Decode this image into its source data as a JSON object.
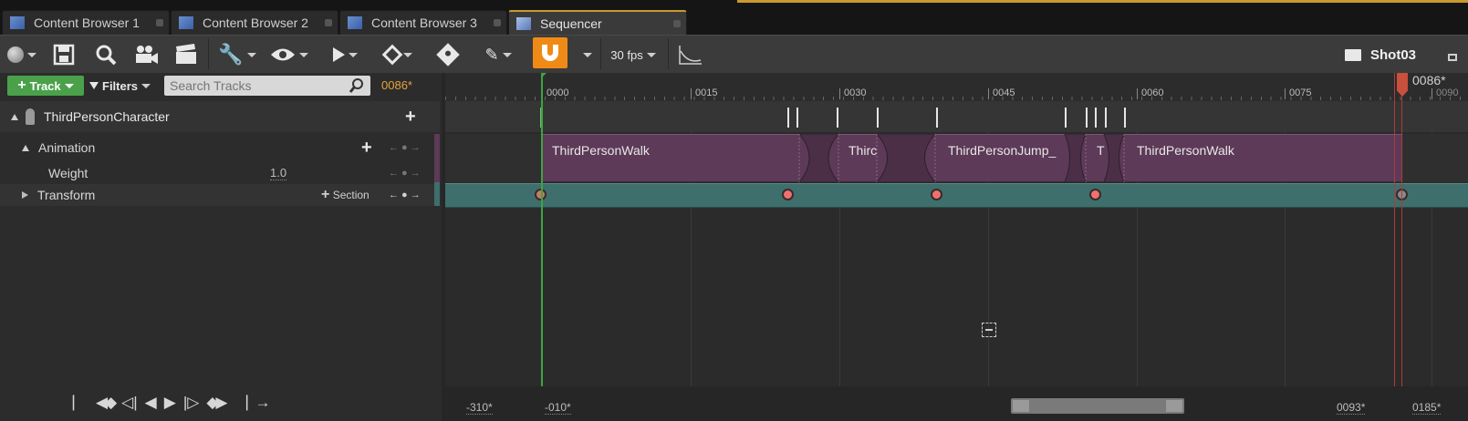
{
  "tabs": [
    {
      "label": "Content Browser 1"
    },
    {
      "label": "Content Browser 2"
    },
    {
      "label": "Content Browser 3"
    },
    {
      "label": "Sequencer"
    }
  ],
  "toolbar": {
    "fps": "30 fps",
    "sequence_name": "Shot03"
  },
  "track_bar": {
    "track_button": "Track",
    "filters_button": "Filters",
    "search_placeholder": "Search Tracks",
    "current_frame": "0086*"
  },
  "tracks": {
    "actor": "ThirdPersonCharacter",
    "animation": "Animation",
    "weight_label": "Weight",
    "weight_value": "1.0",
    "transform": "Transform",
    "section_button": "Section"
  },
  "ruler": {
    "playhead_label": "0086*",
    "ticks": [
      "0000",
      "0015",
      "0030",
      "0045",
      "0060",
      "0075",
      "0090"
    ]
  },
  "clips": {
    "c1": "ThirdPersonWalk",
    "c2": "Thirc",
    "c3": "ThirdPersonJump_",
    "c4": "T",
    "c5": "ThirdPersonWalk"
  },
  "bottom": {
    "view_start": "-310*",
    "work_start": "-010*",
    "work_end": "0093*",
    "view_end": "0185*"
  },
  "colors": {
    "accent_green": "#4aa14a",
    "snap_orange": "#f08a16",
    "clip_purple": "#5d3a58",
    "transform_teal": "#3e6f6c",
    "playhead": "#c8503c",
    "current_frame_orange": "#e8a23a"
  }
}
